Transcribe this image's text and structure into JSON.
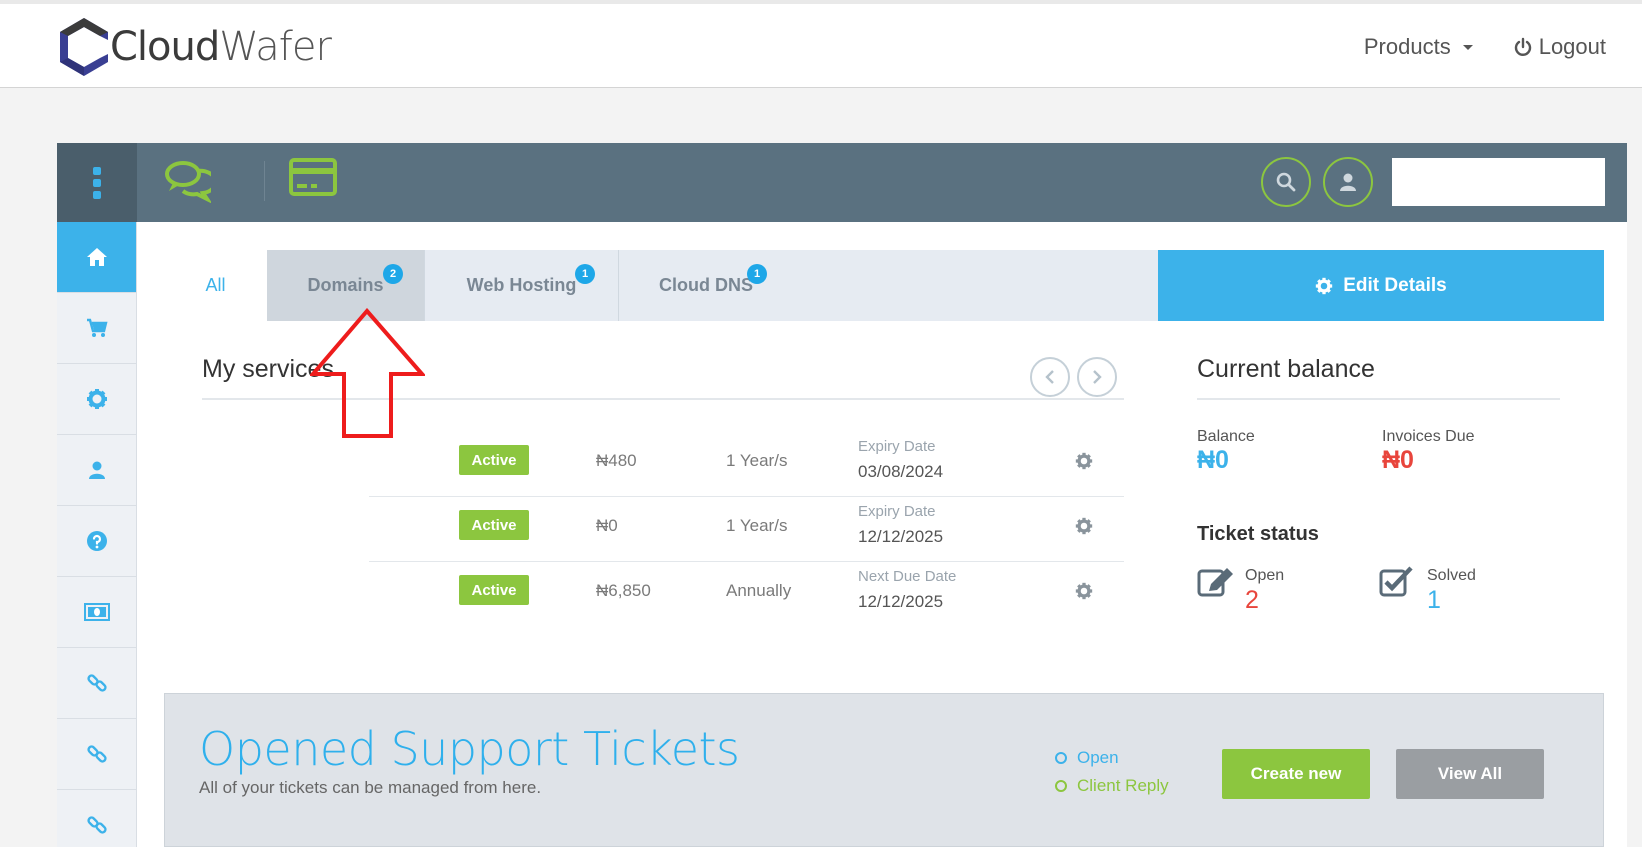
{
  "brand": {
    "name_part1": "Cloud",
    "name_part2": "Wafer"
  },
  "nav": {
    "products": "Products",
    "logout": "Logout"
  },
  "tabs": [
    {
      "label": "All"
    },
    {
      "label": "Domains",
      "badge": "2"
    },
    {
      "label": "Web Hosting",
      "badge": "1"
    },
    {
      "label": "Cloud DNS",
      "badge": "1"
    }
  ],
  "edit_details": "Edit Details",
  "services": {
    "title": "My services",
    "rows": [
      {
        "status": "Active",
        "price": "₦480",
        "cycle": "1 Year/s",
        "date_label": "Expiry Date",
        "date": "03/08/2024"
      },
      {
        "status": "Active",
        "price": "₦0",
        "cycle": "1 Year/s",
        "date_label": "Expiry Date",
        "date": "12/12/2025"
      },
      {
        "status": "Active",
        "price": "₦6,850",
        "cycle": "Annually",
        "date_label": "Next Due Date",
        "date": "12/12/2025"
      }
    ]
  },
  "balance": {
    "title": "Current balance",
    "balance_label": "Balance",
    "balance_value": "₦0",
    "invoices_label": "Invoices Due",
    "invoices_value": "₦0",
    "ticket_title": "Ticket status",
    "open_label": "Open",
    "open_value": "2",
    "solved_label": "Solved",
    "solved_value": "1"
  },
  "support": {
    "title": "Opened Support Tickets",
    "subtitle": "All of your tickets can be managed from here.",
    "legend_open": "Open",
    "legend_reply": "Client Reply",
    "create_new": "Create new",
    "view_all": "View All"
  },
  "colors": {
    "accent": "#3cb2ea",
    "green": "#8cc63f",
    "red": "#e8453c",
    "header": "#5a7180"
  },
  "sidebar_icons": [
    "home-icon",
    "cart-icon",
    "gear-icon",
    "user-icon",
    "help-icon",
    "money-icon",
    "link-icon",
    "link-icon",
    "link-icon"
  ]
}
